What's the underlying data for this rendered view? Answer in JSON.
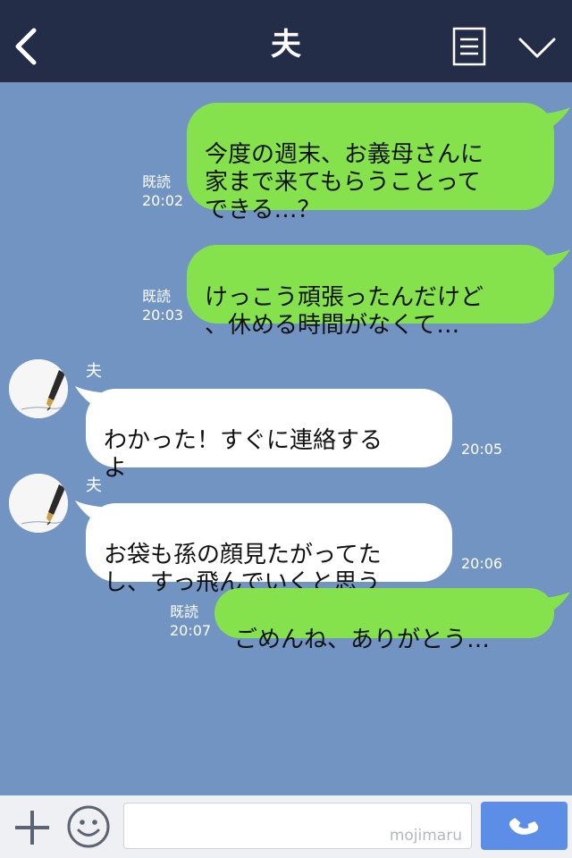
{
  "header": {
    "title": "夫",
    "icons": [
      "chevron-left-icon",
      "notes-icon",
      "chevron-down-icon"
    ]
  },
  "messages": [
    {
      "dir": "out",
      "text": "今度の週末、お義母さんに\n家まで来てもらうことって\nできる…？",
      "read": "既読",
      "time": "20:02"
    },
    {
      "dir": "out",
      "text": "けっこう頑張ったんだけど\n、休める時間がなくて…",
      "read": "既読",
      "time": "20:03"
    },
    {
      "dir": "in",
      "sender": "夫",
      "text": "わかった！すぐに連絡する\nよ",
      "time": "20:05"
    },
    {
      "dir": "in",
      "sender": "夫",
      "text": "お袋も孫の顔見たがってた\nし、すっ飛んでいくと思う",
      "time": "20:06"
    },
    {
      "dir": "out",
      "text": "ごめんね、ありがとう…",
      "read": "既読",
      "time": "20:07"
    }
  ],
  "footer": {
    "input_value": "",
    "watermark": "mojimaru",
    "icons": [
      "plus-icon",
      "smiley-icon",
      "phone-icon"
    ]
  },
  "colors": {
    "header_bg": "#232d48",
    "chat_bg": "#7294c2",
    "outgoing_bubble": "#86e24c",
    "incoming_bubble": "#ffffff",
    "call_button": "#5c8ee7"
  }
}
